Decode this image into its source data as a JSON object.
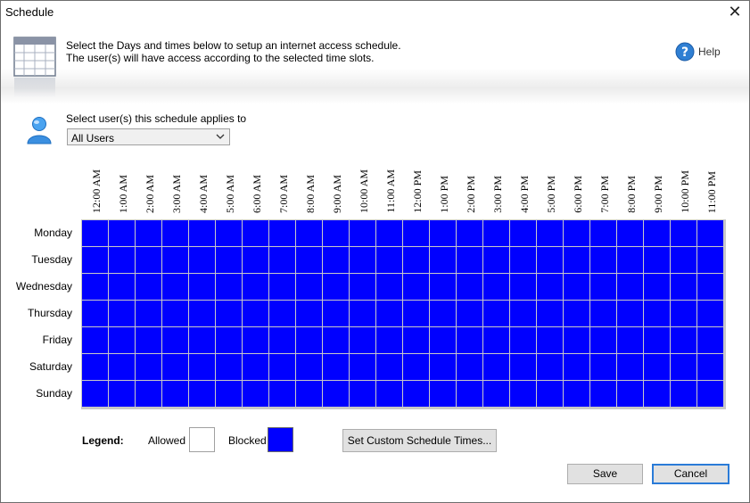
{
  "window": {
    "title": "Schedule"
  },
  "header": {
    "intro_line1": "Select the Days and times below to setup an internet access schedule.",
    "intro_line2": "The user(s) will have access according to the selected time slots.",
    "help_label": "Help"
  },
  "users": {
    "label": "Select user(s) this schedule applies to",
    "selected": "All Users"
  },
  "schedule": {
    "hours": [
      "12:00 AM",
      "1:00 AM",
      "2:00 AM",
      "3:00 AM",
      "4:00 AM",
      "5:00 AM",
      "6:00 AM",
      "7:00 AM",
      "8:00 AM",
      "9:00 AM",
      "10:00 AM",
      "11:00 AM",
      "12:00 PM",
      "1:00 PM",
      "2:00 PM",
      "3:00 PM",
      "4:00 PM",
      "5:00 PM",
      "6:00 PM",
      "7:00 PM",
      "8:00 PM",
      "9:00 PM",
      "10:00 PM",
      "11:00 PM"
    ],
    "days": [
      "Monday",
      "Tuesday",
      "Wednesday",
      "Thursday",
      "Friday",
      "Saturday",
      "Sunday"
    ],
    "all_slots_state": "blocked"
  },
  "legend": {
    "label": "Legend:",
    "allowed_label": "Allowed",
    "blocked_label": "Blocked"
  },
  "colors": {
    "allowed": "#ffffff",
    "blocked": "#0000ff",
    "cell_border": "#c8c8c8"
  },
  "buttons": {
    "custom": "Set Custom Schedule Times...",
    "save": "Save",
    "cancel": "Cancel"
  },
  "icons": {
    "header_icon": "calendar-icon",
    "help_icon": "help-icon",
    "user_icon": "user-icon",
    "dropdown_icon": "chevron-down-icon",
    "close_icon": "close-icon"
  }
}
